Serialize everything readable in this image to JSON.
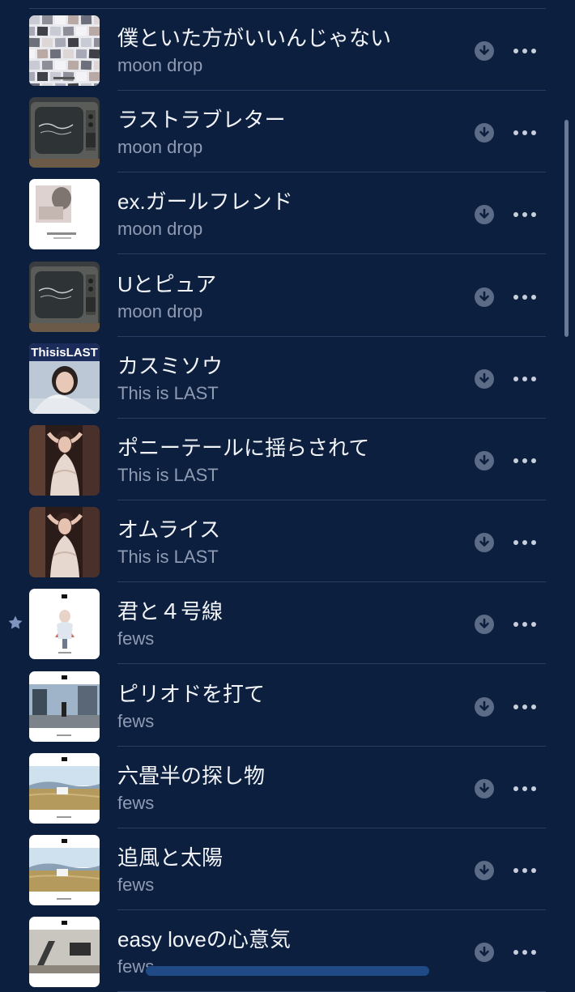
{
  "songs": [
    {
      "title": "僕といた方がいいんじゃない",
      "artist": "moon drop",
      "art": "collage",
      "starred": false
    },
    {
      "title": "ラストラブレター",
      "artist": "moon drop",
      "art": "tv",
      "starred": false
    },
    {
      "title": "ex.ガールフレンド",
      "artist": "moon drop",
      "art": "white-photo",
      "starred": false
    },
    {
      "title": "Uとピュア",
      "artist": "moon drop",
      "art": "tv",
      "starred": false
    },
    {
      "title": "カスミソウ",
      "artist": "This is LAST",
      "art": "thisislast",
      "starred": false
    },
    {
      "title": "ポニーテールに揺らされて",
      "artist": "This is LAST",
      "art": "girl",
      "starred": false
    },
    {
      "title": "オムライス",
      "artist": "This is LAST",
      "art": "girl",
      "starred": false
    },
    {
      "title": "君と４号線",
      "artist": "fews",
      "art": "fews-figure",
      "starred": true
    },
    {
      "title": "ピリオドを打て",
      "artist": "fews",
      "art": "fews-street",
      "starred": false
    },
    {
      "title": "六畳半の探し物",
      "artist": "fews",
      "art": "fews-field",
      "starred": false
    },
    {
      "title": "追風と太陽",
      "artist": "fews",
      "art": "fews-field",
      "starred": false
    },
    {
      "title": "easy loveの心意気",
      "artist": "fews",
      "art": "fews-room",
      "starred": false
    }
  ],
  "art_labels": {
    "thisislast": "ThisisLAST"
  },
  "colors": {
    "background": "#0c1f3f",
    "title": "#f2f4f8",
    "artist": "#8f9bb3",
    "icon": "#5c6b86",
    "star": "#7f95bf"
  },
  "icons": {
    "download": "download-icon",
    "more": "more-icon",
    "star": "star-icon"
  }
}
